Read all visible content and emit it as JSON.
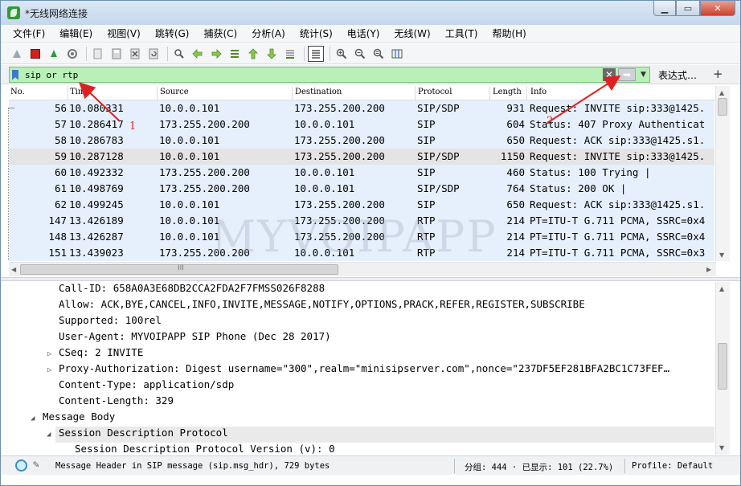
{
  "window": {
    "title": "*无线网络连接",
    "controls": {
      "minimize": "▁",
      "maximize": "▭",
      "close": "✕"
    }
  },
  "menu": [
    "文件(F)",
    "编辑(E)",
    "视图(V)",
    "跳转(G)",
    "捕获(C)",
    "分析(A)",
    "统计(S)",
    "电话(Y)",
    "无线(W)",
    "工具(T)",
    "帮助(H)"
  ],
  "toolbar": {
    "icons": [
      "shark-fin-icon",
      "stop-capture-icon",
      "restart-capture-icon",
      "capture-options-icon",
      "open-file-icon",
      "save-file-icon",
      "close-file-icon",
      "reload-file-icon",
      "find-packet-icon",
      "go-back-icon",
      "go-forward-icon",
      "go-to-packet-icon",
      "first-packet-icon",
      "last-packet-icon",
      "autoscroll-icon",
      "colorize-icon",
      "zoom-in-icon",
      "zoom-out-icon",
      "zoom-normal-icon",
      "resize-columns-icon"
    ]
  },
  "filter": {
    "value": "sip or rtp",
    "expression_label": "表达式…",
    "add_label": "+",
    "clear_glyph": "✕",
    "apply_glyph": "➡",
    "dropdown_glyph": "▼"
  },
  "packet_list": {
    "columns": [
      "No.",
      "Time",
      "Source",
      "Destination",
      "Protocol",
      "Length",
      "Info"
    ],
    "rows": [
      {
        "no": "56",
        "time": "10.080331",
        "src": "10.0.0.101",
        "dst": "173.255.200.200",
        "proto": "SIP/SDP",
        "len": "931",
        "info": "Request: INVITE sip:333@1425."
      },
      {
        "no": "57",
        "time": "10.286417",
        "src": "173.255.200.200",
        "dst": "10.0.0.101",
        "proto": "SIP",
        "len": "604",
        "info": "Status: 407 Proxy Authenticat"
      },
      {
        "no": "58",
        "time": "10.286783",
        "src": "10.0.0.101",
        "dst": "173.255.200.200",
        "proto": "SIP",
        "len": "650",
        "info": "Request: ACK sip:333@1425.s1."
      },
      {
        "no": "59",
        "time": "10.287128",
        "src": "10.0.0.101",
        "dst": "173.255.200.200",
        "proto": "SIP/SDP",
        "len": "1150",
        "info": "Request: INVITE sip:333@1425."
      },
      {
        "no": "60",
        "time": "10.492332",
        "src": "173.255.200.200",
        "dst": "10.0.0.101",
        "proto": "SIP",
        "len": "460",
        "info": "Status: 100 Trying |"
      },
      {
        "no": "61",
        "time": "10.498769",
        "src": "173.255.200.200",
        "dst": "10.0.0.101",
        "proto": "SIP/SDP",
        "len": "764",
        "info": "Status: 200 OK |"
      },
      {
        "no": "62",
        "time": "10.499245",
        "src": "10.0.0.101",
        "dst": "173.255.200.200",
        "proto": "SIP",
        "len": "650",
        "info": "Request: ACK sip:333@1425.s1."
      },
      {
        "no": "147",
        "time": "13.426189",
        "src": "10.0.0.101",
        "dst": "173.255.200.200",
        "proto": "RTP",
        "len": "214",
        "info": "PT=ITU-T G.711 PCMA, SSRC=0x4"
      },
      {
        "no": "148",
        "time": "13.426287",
        "src": "10.0.0.101",
        "dst": "173.255.200.200",
        "proto": "RTP",
        "len": "214",
        "info": "PT=ITU-T G.711 PCMA, SSRC=0x4"
      },
      {
        "no": "151",
        "time": "13.439023",
        "src": "173.255.200.200",
        "dst": "10.0.0.101",
        "proto": "RTP",
        "len": "214",
        "info": "PT=ITU-T G.711 PCMA, SSRC=0x3"
      }
    ],
    "selected_row": "59",
    "hscroll_grip": "III"
  },
  "details": {
    "lines": [
      {
        "text": "Call-ID: 658A0A3E68DB2CCA2FDA2F7FMSS026F8288",
        "indent": 2,
        "caret": ""
      },
      {
        "text": "Allow: ACK,BYE,CANCEL,INFO,INVITE,MESSAGE,NOTIFY,OPTIONS,PRACK,REFER,REGISTER,SUBSCRIBE",
        "indent": 2,
        "caret": ""
      },
      {
        "text": "Supported: 100rel",
        "indent": 2,
        "caret": ""
      },
      {
        "text": "User-Agent: MYVOIPAPP SIP Phone (Dec 28 2017)",
        "indent": 2,
        "caret": ""
      },
      {
        "text": "CSeq: 2 INVITE",
        "indent": 2,
        "caret": "▷"
      },
      {
        "text": "Proxy-Authorization: Digest username=\"300\",realm=\"minisipserver.com\",nonce=\"237DF5EF281BFA2BC1C73FEF…",
        "indent": 2,
        "caret": "▷"
      },
      {
        "text": "Content-Type: application/sdp",
        "indent": 2,
        "caret": ""
      },
      {
        "text": "Content-Length: 329",
        "indent": 2,
        "caret": ""
      },
      {
        "text": "Message Body",
        "indent": 1,
        "caret": "◢"
      },
      {
        "text": "Session Description Protocol",
        "indent": 2,
        "caret": "◢"
      },
      {
        "text": "Session Description Protocol Version (v): 0",
        "indent": 3,
        "caret": ""
      }
    ]
  },
  "status": {
    "message": "Message Header in SIP message (sip.msg_hdr), 729 bytes",
    "packets": "分组: 444 · 已显示: 101 (22.7%)",
    "profile": "Profile: Default"
  },
  "watermark": "MYVOIPAPP",
  "annotations": [
    {
      "label": "1"
    },
    {
      "label": "2"
    }
  ],
  "colors": {
    "row_bg": "#e5f0fc",
    "selected_row_bg": "#e4e4e4",
    "filter_ok_bg": "#b8f0b8",
    "arrow_red": "#e02020"
  }
}
